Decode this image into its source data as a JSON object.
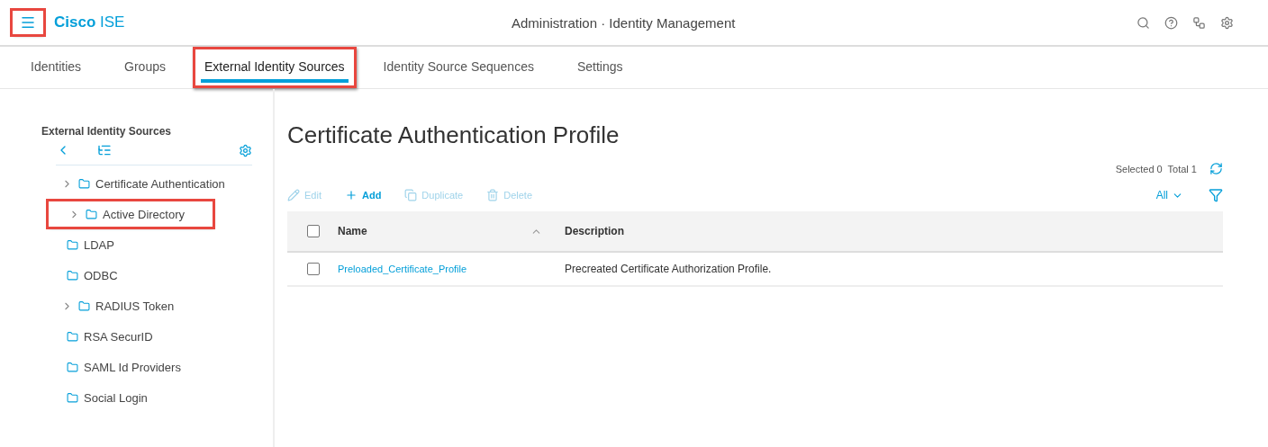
{
  "header": {
    "menu_highlighted": true,
    "brand_bold": "Cisco",
    "brand_rest": "ISE",
    "title": "Administration · Identity Management"
  },
  "tabs": [
    {
      "label": "Identities",
      "selected": false,
      "highlighted": false
    },
    {
      "label": "Groups",
      "selected": false,
      "highlighted": false
    },
    {
      "label": "External Identity Sources",
      "selected": true,
      "highlighted": true
    },
    {
      "label": "Identity Source Sequences",
      "selected": false,
      "highlighted": false
    },
    {
      "label": "Settings",
      "selected": false,
      "highlighted": false
    }
  ],
  "sidebar": {
    "title": "External Identity Sources",
    "items": [
      {
        "label": "Certificate Authentication",
        "expandable": true,
        "highlighted": false
      },
      {
        "label": "Active Directory",
        "expandable": true,
        "highlighted": true
      },
      {
        "label": "LDAP",
        "expandable": false,
        "highlighted": false
      },
      {
        "label": "ODBC",
        "expandable": false,
        "highlighted": false
      },
      {
        "label": "RADIUS Token",
        "expandable": true,
        "highlighted": false
      },
      {
        "label": "RSA SecurID",
        "expandable": false,
        "highlighted": false
      },
      {
        "label": "SAML Id Providers",
        "expandable": false,
        "highlighted": false
      },
      {
        "label": "Social Login",
        "expandable": false,
        "highlighted": false
      }
    ]
  },
  "page_title": "Certificate Authentication Profile",
  "summary": "Selected 0  Total 1",
  "actions": [
    {
      "kind": "edit",
      "label": "Edit",
      "disabled": true
    },
    {
      "kind": "add",
      "label": "Add",
      "disabled": false
    },
    {
      "kind": "duplicate",
      "label": "Duplicate",
      "disabled": true
    },
    {
      "kind": "delete",
      "label": "Delete",
      "disabled": true
    }
  ],
  "filter_label": "All",
  "table": {
    "columns": [
      "Name",
      "Description"
    ],
    "rows": [
      {
        "checked": false,
        "name": "Preloaded_Certificate_Profile",
        "description": "Precreated Certificate Authorization Profile."
      }
    ],
    "header_checked": false
  }
}
